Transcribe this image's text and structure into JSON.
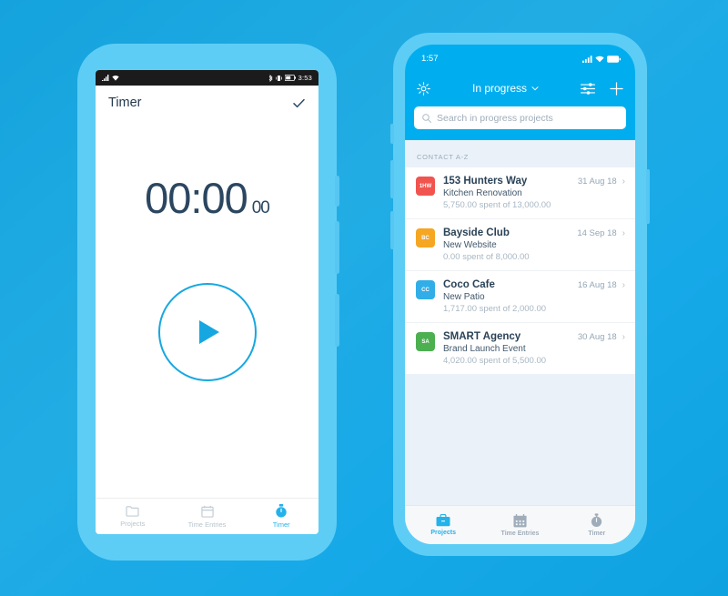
{
  "background": {
    "color_top": "#15a3dd",
    "color_bottom": "#0fa2e0"
  },
  "phone_left": {
    "platform": "android",
    "frame_color": "#5ecdf5",
    "status_bar": {
      "clock": "3:53",
      "left_icons": [
        "signal-icon",
        "wifi-icon"
      ],
      "right_icons": [
        "bluetooth-icon",
        "vibrate-icon",
        "battery-icon"
      ]
    },
    "appbar": {
      "title": "Timer",
      "action_icon": "check-icon"
    },
    "timer": {
      "main": "00:00",
      "fraction": "00",
      "play_icon": "play-icon",
      "accent_color": "#17a7e0",
      "text_color": "#2b4660"
    },
    "tabbar": {
      "items": [
        {
          "label": "Projects",
          "icon": "folder-icon",
          "active": false
        },
        {
          "label": "Time Entries",
          "icon": "calendar-icon",
          "active": false
        },
        {
          "label": "Timer",
          "icon": "stopwatch-icon",
          "active": true
        }
      ],
      "active_color": "#24b2ea",
      "inactive_color": "#b8c4cc"
    }
  },
  "phone_right": {
    "platform": "ios",
    "frame_color": "#5ecdf5",
    "accent_color": "#00AEEF",
    "status_bar": {
      "clock": "1:57",
      "right_icons": [
        "cellular-icon",
        "wifi-icon",
        "battery-icon"
      ]
    },
    "header": {
      "settings_icon": "gear-icon",
      "title": "In progress",
      "dropdown_icon": "chevron-down-icon",
      "filter_icon": "filter-sliders-icon",
      "add_icon": "plus-icon"
    },
    "search": {
      "icon": "search-icon",
      "placeholder": "Search in progress projects",
      "value": ""
    },
    "section_label": "CONTACT A-Z",
    "projects": [
      {
        "initials": "1HW",
        "avatar_color": "#F1544F",
        "name": "153 Hunters Way",
        "job": "Kitchen Renovation",
        "amount": "5,750.00 spent of 13,000.00",
        "date": "31 Aug 18",
        "chevron": "chevron-right-icon"
      },
      {
        "initials": "BC",
        "avatar_color": "#F5A623",
        "name": "Bayside Club",
        "job": "New Website",
        "amount": "0.00 spent of 8,000.00",
        "date": "14 Sep 18",
        "chevron": "chevron-right-icon"
      },
      {
        "initials": "CC",
        "avatar_color": "#31AEE8",
        "name": "Coco Cafe",
        "job": "New Patio",
        "amount": "1,717.00 spent of 2,000.00",
        "date": "16 Aug 18",
        "chevron": "chevron-right-icon"
      },
      {
        "initials": "SA",
        "avatar_color": "#4CAF50",
        "name": "SMART Agency",
        "job": "Brand Launch Event",
        "amount": "4,020.00 spent of 5,500.00",
        "date": "30 Aug 18",
        "chevron": "chevron-right-icon"
      }
    ],
    "tabbar": {
      "items": [
        {
          "label": "Projects",
          "icon": "briefcase-icon",
          "active": true
        },
        {
          "label": "Time Entries",
          "icon": "calendar-icon",
          "active": false
        },
        {
          "label": "Timer",
          "icon": "stopwatch-icon",
          "active": false
        }
      ],
      "active_color": "#24b2ea",
      "inactive_color": "#9fadba"
    }
  }
}
